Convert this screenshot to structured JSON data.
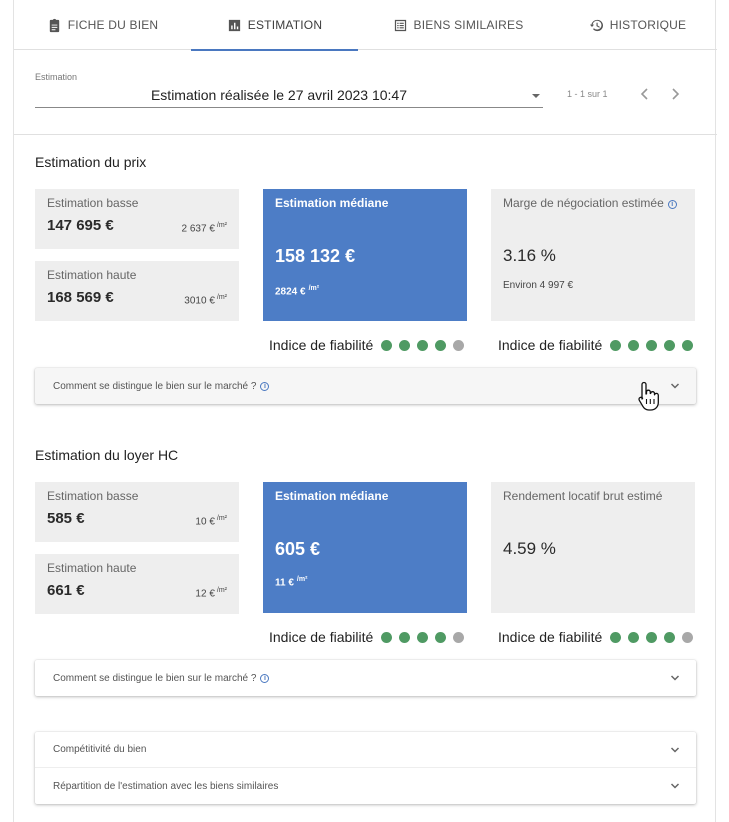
{
  "tabs": [
    {
      "label": "FICHE DU BIEN",
      "icon": "clipboard-icon",
      "active": false
    },
    {
      "label": "ESTIMATION",
      "icon": "bar-chart-icon",
      "active": true
    },
    {
      "label": "BIENS SIMILAIRES",
      "icon": "list-icon",
      "active": false
    },
    {
      "label": "HISTORIQUE",
      "icon": "history-icon",
      "active": false
    }
  ],
  "selector": {
    "label": "Estimation",
    "value": "Estimation réalisée le 27 avril 2023 10:47",
    "pager": "1 - 1 sur 1"
  },
  "prix": {
    "title": "Estimation du prix",
    "basse": {
      "label": "Estimation basse",
      "value": "147 695 €",
      "ppm": "2 637 €",
      "unit": "/m²"
    },
    "haute": {
      "label": "Estimation haute",
      "value": "168 569 €",
      "ppm": "3010 €",
      "unit": "/m²"
    },
    "mediane": {
      "label": "Estimation médiane",
      "value": "158 132 €",
      "ppm": "2824 €",
      "unit": "/m²"
    },
    "marge": {
      "label": "Marge de négociation estimée",
      "value": "3.16 %",
      "sub": "Environ 4 997 €"
    },
    "fiab_label": "Indice de fiabilité",
    "fiab_mediane": 4,
    "fiab_marge": 5,
    "panel_label": "Comment se distingue le bien sur le marché ?"
  },
  "loyer": {
    "title": "Estimation du loyer HC",
    "basse": {
      "label": "Estimation basse",
      "value": "585 €",
      "ppm": "10 €",
      "unit": "/m²"
    },
    "haute": {
      "label": "Estimation haute",
      "value": "661 €",
      "ppm": "12 €",
      "unit": "/m²"
    },
    "mediane": {
      "label": "Estimation médiane",
      "value": "605 €",
      "ppm": "11 €",
      "unit": "/m²"
    },
    "rendement": {
      "label": "Rendement locatif brut estimé",
      "value": "4.59 %"
    },
    "fiab_label": "Indice de fiabilité",
    "fiab_mediane": 4,
    "fiab_rendement": 4,
    "panel_label": "Comment se distingue le bien sur le marché ?"
  },
  "bottom_panels": [
    {
      "label": "Compétitivité du bien"
    },
    {
      "label": "Répartition de l'estimation avec les biens similaires"
    }
  ],
  "colors": {
    "accent": "#4d7dc6",
    "dot_on": "#4f9a63",
    "dot_off": "#a8a8a8"
  }
}
